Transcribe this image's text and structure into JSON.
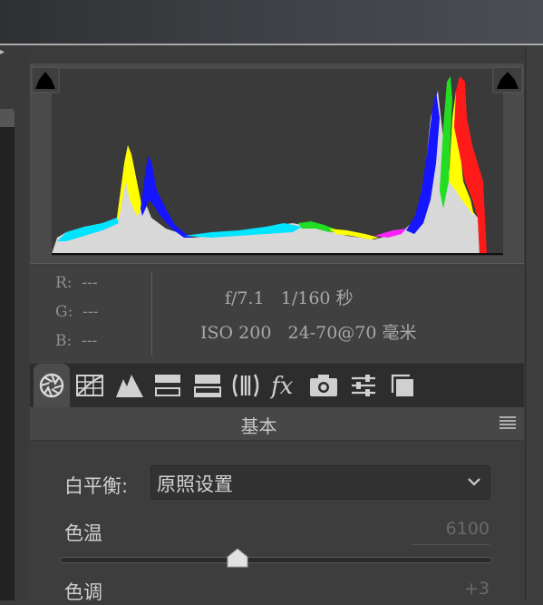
{
  "histogram": {
    "clip_shadow_icon": "shadow-clipping-warning-icon",
    "clip_highlight_icon": "highlight-clipping-warning-icon",
    "colors": {
      "red": "#ff1a1a",
      "green": "#22dd22",
      "blue": "#1515ff",
      "cyan": "#00e5ff",
      "yellow": "#ffff00",
      "magenta": "#ff22ff",
      "white": "#d8d8d8"
    }
  },
  "exif": {
    "r": "R:  ---",
    "g": "G:  ---",
    "b": "B:  ---",
    "aperture_shutter": "f/7.1   1/160 秒",
    "iso_lens": "ISO 200   24-70@70 毫米"
  },
  "tabs": [
    {
      "icon": "aperture-icon",
      "active": true
    },
    {
      "icon": "tone-curve-grid-icon",
      "active": false
    },
    {
      "icon": "mountain-detail-icon",
      "active": false
    },
    {
      "icon": "hsl-grayscale-icon",
      "active": false
    },
    {
      "icon": "split-toning-icon",
      "active": false
    },
    {
      "icon": "lens-corrections-icon",
      "active": false
    },
    {
      "icon": "fx-effects-icon",
      "active": false
    },
    {
      "icon": "camera-calibration-icon",
      "active": false
    },
    {
      "icon": "presets-sliders-icon",
      "active": false
    },
    {
      "icon": "snapshots-icon",
      "active": false
    }
  ],
  "panel": {
    "title": "基本",
    "menu_icon": "panel-menu-icon"
  },
  "white_balance": {
    "label": "白平衡:",
    "value": "原照设置"
  },
  "temperature": {
    "label": "色温",
    "value": "6100",
    "slider_fraction": 0.41
  },
  "tint": {
    "label": "色调",
    "value": "+3"
  }
}
